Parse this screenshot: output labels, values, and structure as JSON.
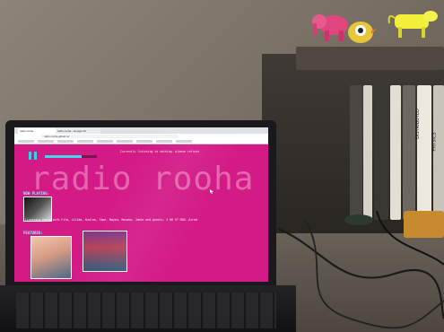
{
  "browser": {
    "tabs": [
      "radio rooha",
      "radio rooha - Google Ch"
    ],
    "url": "radio-rooha.github.io/"
  },
  "page": {
    "title": "radio rooha",
    "notice": "Currently listening to nothing. please refresh",
    "now_playing_label": "NOW PLAYING:",
    "listen_line": "Listening Party with Film, Lilika, Kuulaa, Tape, Nayon, Rosana, Jamie and guests. 2 HR 57 MIN. Aired",
    "playlist_label": "FEATURED:",
    "progress": 0.7
  },
  "scene": {
    "books": [
      "DISTRIBUTED",
      "PHYSICS"
    ]
  },
  "colors": {
    "page_bg": "#d31a87",
    "accent": "#44d6ea",
    "title_ghost": "#e874b6"
  }
}
